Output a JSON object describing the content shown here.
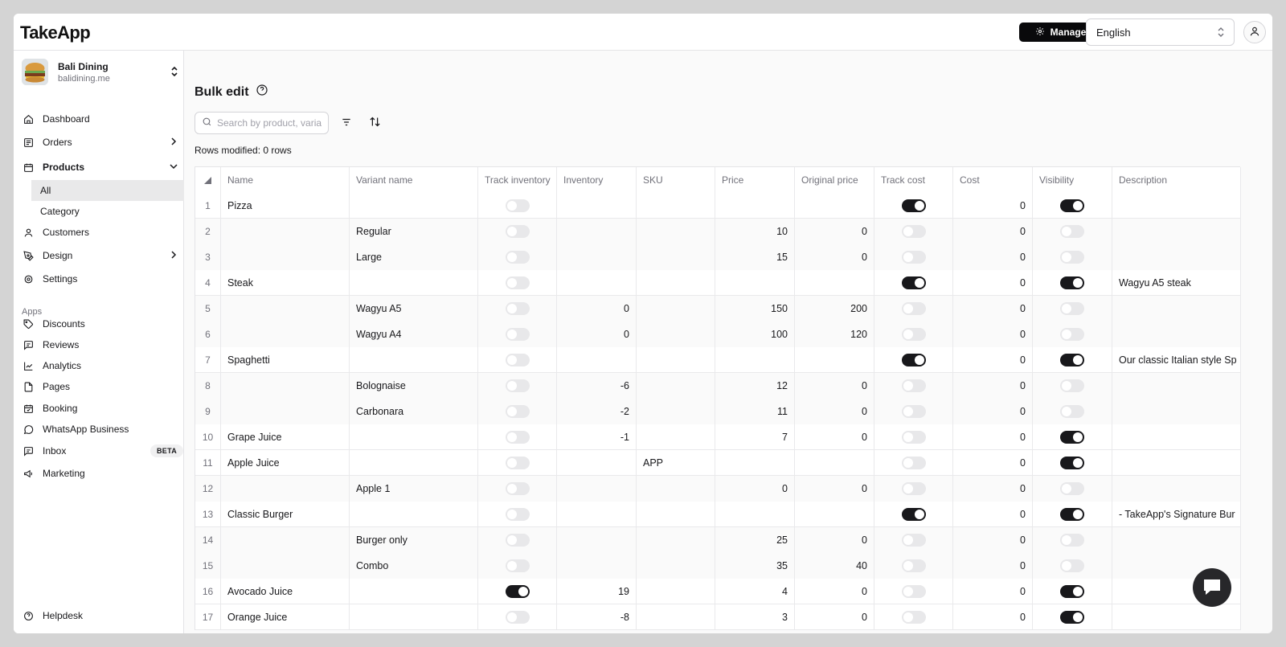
{
  "app": {
    "logo": "TakeApp"
  },
  "header": {
    "manage_label": "Manage",
    "language": "English"
  },
  "store": {
    "name": "Bali Dining",
    "url": "balidining.me"
  },
  "nav": {
    "dashboard": "Dashboard",
    "orders": "Orders",
    "products": "Products",
    "products_all": "All",
    "products_category": "Category",
    "customers": "Customers",
    "design": "Design",
    "settings": "Settings",
    "apps_label": "Apps",
    "discounts": "Discounts",
    "reviews": "Reviews",
    "analytics": "Analytics",
    "pages": "Pages",
    "booking": "Booking",
    "whatsapp": "WhatsApp Business",
    "inbox": "Inbox",
    "inbox_badge": "BETA",
    "marketing": "Marketing",
    "helpdesk": "Helpdesk"
  },
  "page": {
    "title": "Bulk edit",
    "search_placeholder": "Search by product, variant",
    "rows_modified": "Rows modified: 0 rows"
  },
  "table": {
    "columns": [
      "Name",
      "Variant name",
      "Track inventory",
      "Inventory",
      "SKU",
      "Price",
      "Original price",
      "Track cost",
      "Cost",
      "Visibility",
      "Description"
    ],
    "rows": [
      {
        "idx": "1",
        "name": "Pizza",
        "variant": "",
        "track_inventory": false,
        "inventory": "",
        "sku": "",
        "price": "",
        "original_price": "",
        "track_cost": true,
        "cost": "0",
        "visibility": true,
        "description": ""
      },
      {
        "idx": "2",
        "name": "",
        "variant": "Regular",
        "track_inventory": false,
        "inventory": "",
        "sku": "",
        "price": "10",
        "original_price": "0",
        "track_cost": false,
        "cost": "0",
        "visibility": false,
        "description": ""
      },
      {
        "idx": "3",
        "name": "",
        "variant": "Large",
        "track_inventory": false,
        "inventory": "",
        "sku": "",
        "price": "15",
        "original_price": "0",
        "track_cost": false,
        "cost": "0",
        "visibility": false,
        "description": ""
      },
      {
        "idx": "4",
        "name": "Steak",
        "variant": "",
        "track_inventory": false,
        "inventory": "",
        "sku": "",
        "price": "",
        "original_price": "",
        "track_cost": true,
        "cost": "0",
        "visibility": true,
        "description": "Wagyu A5 steak"
      },
      {
        "idx": "5",
        "name": "",
        "variant": "Wagyu A5",
        "track_inventory": false,
        "inventory": "0",
        "sku": "",
        "price": "150",
        "original_price": "200",
        "track_cost": false,
        "cost": "0",
        "visibility": false,
        "description": ""
      },
      {
        "idx": "6",
        "name": "",
        "variant": "Wagyu A4",
        "track_inventory": false,
        "inventory": "0",
        "sku": "",
        "price": "100",
        "original_price": "120",
        "track_cost": false,
        "cost": "0",
        "visibility": false,
        "description": ""
      },
      {
        "idx": "7",
        "name": "Spaghetti",
        "variant": "",
        "track_inventory": false,
        "inventory": "",
        "sku": "",
        "price": "",
        "original_price": "",
        "track_cost": true,
        "cost": "0",
        "visibility": true,
        "description": "Our classic Italian style Sp"
      },
      {
        "idx": "8",
        "name": "",
        "variant": "Bolognaise",
        "track_inventory": false,
        "inventory": "-6",
        "sku": "",
        "price": "12",
        "original_price": "0",
        "track_cost": false,
        "cost": "0",
        "visibility": false,
        "description": ""
      },
      {
        "idx": "9",
        "name": "",
        "variant": "Carbonara",
        "track_inventory": false,
        "inventory": "-2",
        "sku": "",
        "price": "11",
        "original_price": "0",
        "track_cost": false,
        "cost": "0",
        "visibility": false,
        "description": ""
      },
      {
        "idx": "10",
        "name": "Grape Juice",
        "variant": "",
        "track_inventory": false,
        "inventory": "-1",
        "sku": "",
        "price": "7",
        "original_price": "0",
        "track_cost": false,
        "cost": "0",
        "visibility": true,
        "description": ""
      },
      {
        "idx": "11",
        "name": "Apple Juice",
        "variant": "",
        "track_inventory": false,
        "inventory": "",
        "sku": "APP",
        "price": "",
        "original_price": "",
        "track_cost": false,
        "cost": "0",
        "visibility": true,
        "description": ""
      },
      {
        "idx": "12",
        "name": "",
        "variant": "Apple 1",
        "track_inventory": false,
        "inventory": "",
        "sku": "",
        "price": "0",
        "original_price": "0",
        "track_cost": false,
        "cost": "0",
        "visibility": false,
        "description": ""
      },
      {
        "idx": "13",
        "name": "Classic Burger",
        "variant": "",
        "track_inventory": false,
        "inventory": "",
        "sku": "",
        "price": "",
        "original_price": "",
        "track_cost": true,
        "cost": "0",
        "visibility": true,
        "description": "- TakeApp's Signature Bur"
      },
      {
        "idx": "14",
        "name": "",
        "variant": "Burger only",
        "track_inventory": false,
        "inventory": "",
        "sku": "",
        "price": "25",
        "original_price": "0",
        "track_cost": false,
        "cost": "0",
        "visibility": false,
        "description": ""
      },
      {
        "idx": "15",
        "name": "",
        "variant": "Combo",
        "track_inventory": false,
        "inventory": "",
        "sku": "",
        "price": "35",
        "original_price": "40",
        "track_cost": false,
        "cost": "0",
        "visibility": false,
        "description": ""
      },
      {
        "idx": "16",
        "name": "Avocado Juice",
        "variant": "",
        "track_inventory": true,
        "inventory": "19",
        "sku": "",
        "price": "4",
        "original_price": "0",
        "track_cost": false,
        "cost": "0",
        "visibility": true,
        "description": ""
      },
      {
        "idx": "17",
        "name": "Orange Juice",
        "variant": "",
        "track_inventory": false,
        "inventory": "-8",
        "sku": "",
        "price": "3",
        "original_price": "0",
        "track_cost": false,
        "cost": "0",
        "visibility": true,
        "description": ""
      }
    ]
  },
  "colors": {
    "accent": "#18181b",
    "toggle_off": "#e8e8ea",
    "background": "#fafafa"
  }
}
